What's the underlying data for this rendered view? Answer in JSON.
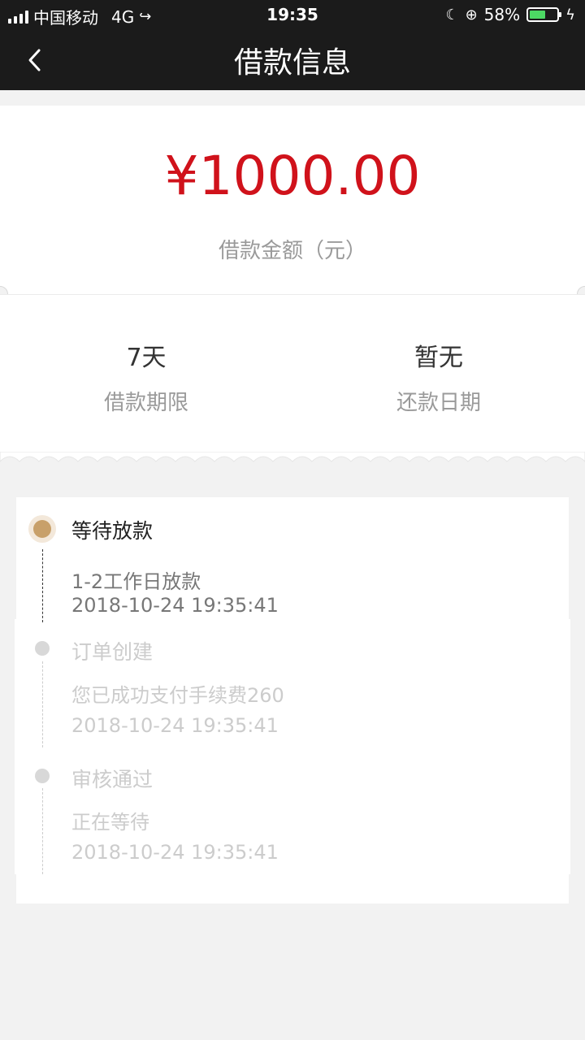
{
  "status_bar": {
    "carrier": "中国移动",
    "network": "4G",
    "time": "19:35",
    "battery_percent": "58%",
    "battery_level": 0.58
  },
  "nav": {
    "title": "借款信息",
    "back_icon": "chevron-left-icon"
  },
  "loan": {
    "amount": "¥1000.00",
    "amount_label": "借款金额（元）",
    "term_value": "7天",
    "term_label": "借款期限",
    "repay_value": "暂无",
    "repay_label": "还款日期"
  },
  "timeline": [
    {
      "title": "等待放款",
      "detail": "1-2工作日放款",
      "time": "2018-10-24 19:35:41",
      "active": true
    },
    {
      "title": "订单创建",
      "detail": "您已成功支付手续费260",
      "time": "2018-10-24 19:35:41",
      "active": false
    },
    {
      "title": "审核通过",
      "detail": "正在等待",
      "time": "2018-10-24 19:35:41",
      "active": false
    }
  ],
  "colors": {
    "accent": "#d0121b",
    "active_dot": "#c8a06a",
    "inactive_text": "#cccccc",
    "header_bg": "#1b1b1b"
  }
}
